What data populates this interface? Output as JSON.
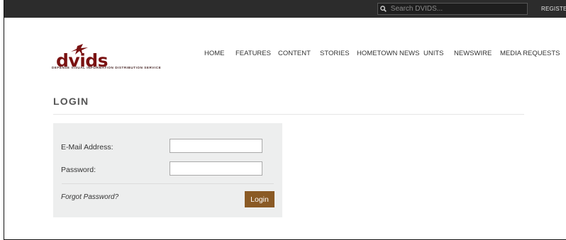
{
  "topbar": {
    "search_placeholder": "Search DVIDS...",
    "search_icon": "search-icon",
    "register_label": "REGISTER"
  },
  "logo": {
    "wordmark": "dvids",
    "tagline": "DEFENSE VISUAL INFORMATION DISTRIBUTION SERVICE",
    "brand_color": "#7a1212"
  },
  "nav": {
    "items": [
      "HOME",
      "FEATURES",
      "CONTENT",
      "STORIES",
      "HOMETOWN NEWS",
      "UNITS",
      "NEWSWIRE",
      "MEDIA REQUESTS"
    ]
  },
  "page": {
    "title": "LOGIN"
  },
  "form": {
    "email_label": "E-Mail Address:",
    "email_value": "",
    "password_label": "Password:",
    "password_value": "",
    "forgot_label": "Forgot Password?",
    "submit_label": "Login",
    "submit_color": "#8a5a25"
  }
}
